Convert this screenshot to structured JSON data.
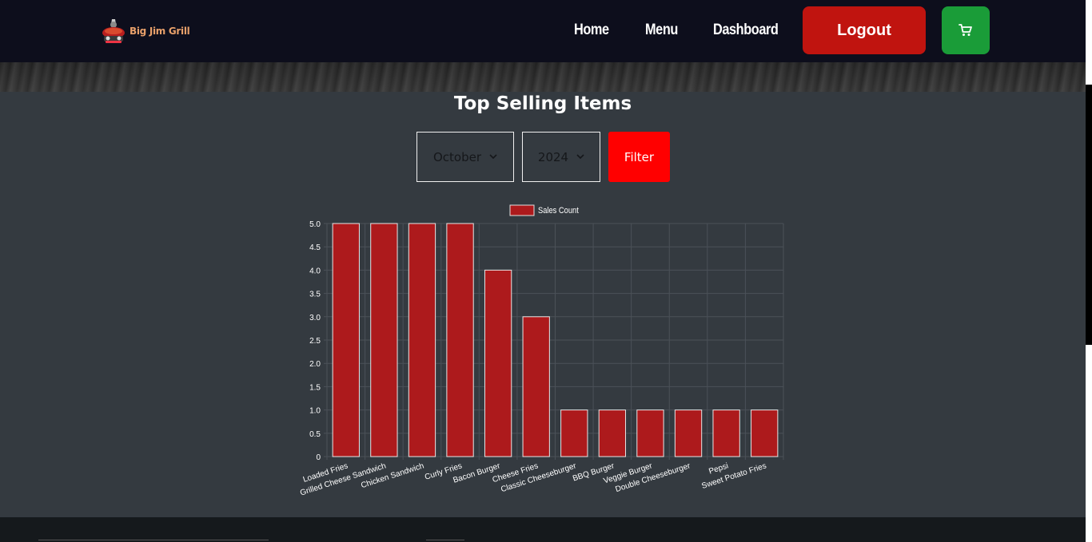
{
  "brand": {
    "name": "Big Jim Grill"
  },
  "nav": {
    "links": [
      "Home",
      "Menu",
      "Dashboard"
    ],
    "logout_label": "Logout",
    "cart_icon": "cart-icon"
  },
  "page": {
    "title": "Top Selling Items"
  },
  "filters": {
    "month": "October",
    "year": "2024",
    "filter_label": "Filter"
  },
  "colors": {
    "navbar": "#0d0e1c",
    "logout": "#c0140f",
    "cart": "#1a9c38",
    "filter": "#ff0000",
    "bar": "#ad1a1c"
  },
  "chart_data": {
    "type": "bar",
    "categories": [
      "Loaded Fries",
      "Grilled Cheese Sandwich",
      "Chicken Sandwich",
      "Curly Fries",
      "Bacon Burger",
      "Cheese Fries",
      "Classic Cheeseburger",
      "BBQ Burger",
      "Veggie Burger",
      "Double Cheeseburger",
      "Pepsi",
      "Sweet Potato Fries"
    ],
    "series": [
      {
        "name": "Sales Count",
        "values": [
          5,
          5,
          5,
          5,
          4,
          3,
          1,
          1,
          1,
          1,
          1,
          1
        ]
      }
    ],
    "ylim": [
      0,
      5
    ],
    "yticks": [
      "0",
      "0.5",
      "1.0",
      "1.5",
      "2.0",
      "2.5",
      "3.0",
      "3.5",
      "4.0",
      "4.5",
      "5.0"
    ],
    "grid": true,
    "legend": "top-center"
  }
}
